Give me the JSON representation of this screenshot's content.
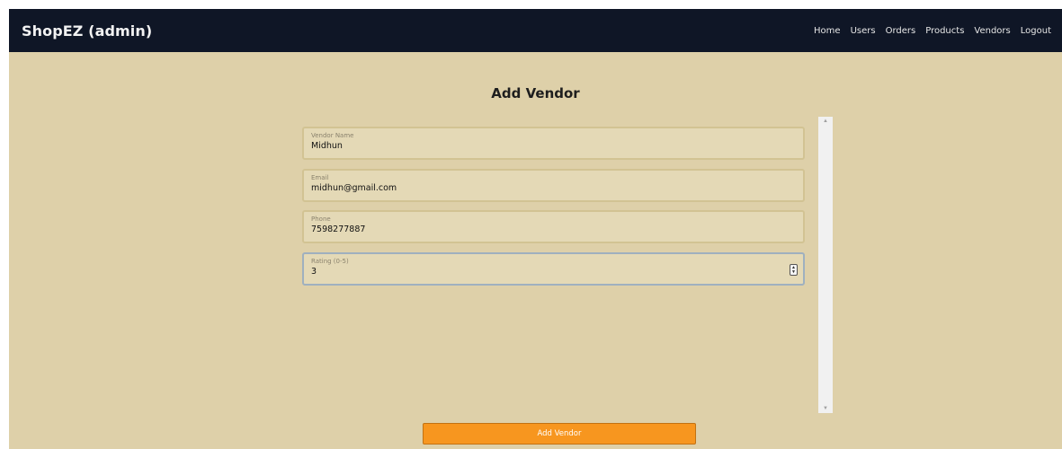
{
  "app": {
    "brand": "ShopEZ (admin)"
  },
  "nav": {
    "items": [
      {
        "label": "Home"
      },
      {
        "label": "Users"
      },
      {
        "label": "Orders"
      },
      {
        "label": "Products"
      },
      {
        "label": "Vendors"
      },
      {
        "label": "Logout"
      }
    ]
  },
  "form": {
    "title": "Add Vendor",
    "fields": [
      {
        "label": "Vendor Name",
        "value": "Midhun"
      },
      {
        "label": "Email",
        "value": "midhun@gmail.com"
      },
      {
        "label": "Phone",
        "value": "7598277887"
      },
      {
        "label": "Rating (0-5)",
        "value": "3"
      }
    ],
    "submit_label": "Add Vendor"
  },
  "icons": {
    "stepper": "number-stepper-icon",
    "scroll_up": "scroll-up-arrow-icon",
    "scroll_down": "scroll-down-arrow-icon"
  },
  "colors": {
    "navbar_bg": "#0f1626",
    "page_bg": "#ded0a9",
    "field_bg": "#e4d9b6",
    "button_bg": "#f7961f"
  }
}
